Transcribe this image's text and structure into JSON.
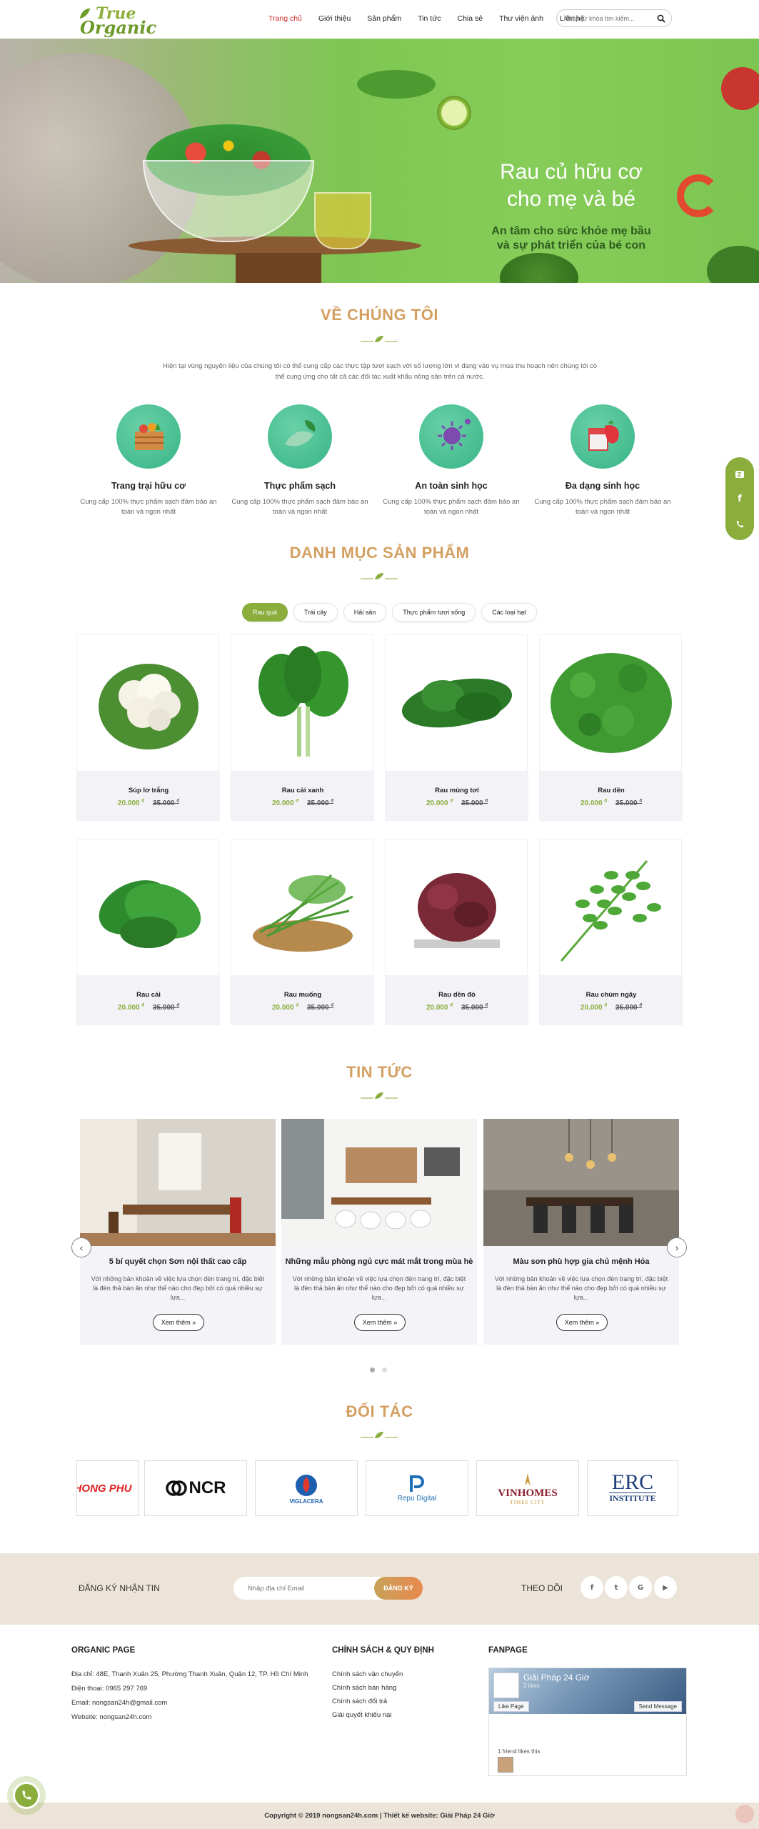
{
  "header": {
    "logo_line1": "True",
    "logo_line2": "Organic",
    "nav": [
      "Trang chủ",
      "Giới thiệu",
      "Sản phẩm",
      "Tin tức",
      "Chia sẻ",
      "Thư viện ảnh",
      "Liên hệ"
    ],
    "search_placeholder": "Nhập từ khóa tìm kiếm..."
  },
  "hero": {
    "title_line1": "Rau củ hữu cơ",
    "title_line2": "cho mẹ và bé",
    "subtitle_line1": "An tâm cho sức khỏe mẹ bầu",
    "subtitle_line2": "và sự phát triển của bé con",
    "active_slide": 1,
    "slides": 2
  },
  "about": {
    "title": "VỀ CHÚNG TÔI",
    "text": "Hiện tại vùng nguyên liệu của chúng tôi có thể cung cấp các thực tập tươi sạch với số lượng lớn vì đang vào vụ mùa thu hoạch nên chúng tôi có thể cung ứng cho tất cả các đối tác xuất khẩu nông sản trên cả nước.",
    "features": [
      {
        "title": "Trang trại hữu cơ",
        "desc": "Cung cấp 100% thực phẩm sạch đảm bảo an toàn và ngon nhất",
        "icon": "crate-icon"
      },
      {
        "title": "Thực phẩm sạch",
        "desc": "Cung cấp 100% thực phẩm sạch đảm bảo an toàn và ngon nhất",
        "icon": "leaf-scoop-icon"
      },
      {
        "title": "An toàn sinh học",
        "desc": "Cung cấp 100% thực phẩm sạch đảm bảo an toàn và ngon nhất",
        "icon": "virus-icon"
      },
      {
        "title": "Đa dạng sinh học",
        "desc": "Cung cấp 100% thực phẩm sạch đảm bảo an toàn và ngon nhất",
        "icon": "strawberry-icon"
      }
    ]
  },
  "products": {
    "title": "DANH MỤC SẢN PHẨM",
    "tabs": [
      "Rau quả",
      "Trái cây",
      "Hải sản",
      "Thực phẩm tươi sống",
      "Các loại hạt"
    ],
    "active_tab": 0,
    "currency": "đ",
    "items": [
      {
        "name": "Súp lơ trắng",
        "price": "20.000",
        "old_price": "35.000"
      },
      {
        "name": "Rau cải xanh",
        "price": "20.000",
        "old_price": "35.000"
      },
      {
        "name": "Rau mùng tơi",
        "price": "20.000",
        "old_price": "35.000"
      },
      {
        "name": "Rau dền",
        "price": "20.000",
        "old_price": "35.000"
      },
      {
        "name": "Rau cải",
        "price": "20.000",
        "old_price": "35.000"
      },
      {
        "name": "Rau muống",
        "price": "20.000",
        "old_price": "35.000"
      },
      {
        "name": "Rau dền đỏ",
        "price": "20.000",
        "old_price": "35.000"
      },
      {
        "name": "Rau chùm ngây",
        "price": "20.000",
        "old_price": "35.000"
      }
    ]
  },
  "news": {
    "title": "TIN TỨC",
    "items": [
      {
        "title": "5 bí quyết chọn Sơn nội thất cao cấp",
        "excerpt": "Với những bản khoản về việc lựa chọn đèn trang trí, đặc biệt là đèn thả bàn ăn như thế nào cho đẹp bởi có quá nhiều sự lựa...",
        "button": "Xem thêm »"
      },
      {
        "title": "Những mẫu phòng ngủ cực mát mắt trong mùa hè",
        "excerpt": "Với những bản khoản về việc lựa chọn đèn trang trí, đặc biệt là đèn thả bàn ăn như thế nào cho đẹp bởi có quá nhiều sự lựa...",
        "button": "Xem thêm »"
      },
      {
        "title": "Màu sơn phù hợp gia chủ mệnh Hỏa",
        "excerpt": "Với những bản khoản về việc lựa chọn đèn trang trí, đặc biệt là đèn thả bàn ăn như thế nào cho đẹp bởi có quá nhiều sự lựa...",
        "button": "Xem thêm »"
      }
    ]
  },
  "partners": {
    "title": "ĐỐI TÁC",
    "logos": [
      "HONG PHU",
      "NCR",
      "VIGLACERA",
      "Repu Digital",
      "VINHOMES",
      "ERC INSTITUTE"
    ],
    "vinhomes_sub": "TIMES CITY"
  },
  "newsletter": {
    "label": "ĐĂNG KÝ NHẬN TIN",
    "placeholder": "Nhập địa chỉ Email",
    "button": "ĐĂNG KÝ",
    "follow_label": "THEO DÕI",
    "socials": [
      "f",
      "t",
      "G",
      "▶"
    ]
  },
  "footer": {
    "col1_title": "ORGANIC PAGE",
    "address": "Địa chỉ: 48E, Thanh Xuân 25, Phường Thanh Xuân, Quận 12, TP. Hồ Chí Minh",
    "phone": "Điện thoại: 0965 297 769",
    "email": "Email: nongsan24h@gmail.com",
    "website": "Website: nongsan24h.com",
    "col2_title": "CHÍNH SÁCH & QUY ĐỊNH",
    "policies": [
      "Chính sách vận chuyển",
      "Chính sách bán hàng",
      "Chính sách đổi trả",
      "Giải quyết khiếu nại"
    ],
    "col3_title": "FANPAGE",
    "fb_page": "Giải Pháp 24 Giờ",
    "fb_likes": "2 likes",
    "fb_like_btn": "Like Page",
    "fb_send_btn": "Send Message",
    "fb_friends": "1 friend likes this",
    "copyright": "Copyright © 2019 nongsan24h.com | Thiết kế website: Giải Pháp 24 Giờ"
  },
  "colors": {
    "accent": "#8aad3c",
    "title": "#d4a062",
    "nav_active": "#d0312d",
    "band": "#ece4d8"
  }
}
